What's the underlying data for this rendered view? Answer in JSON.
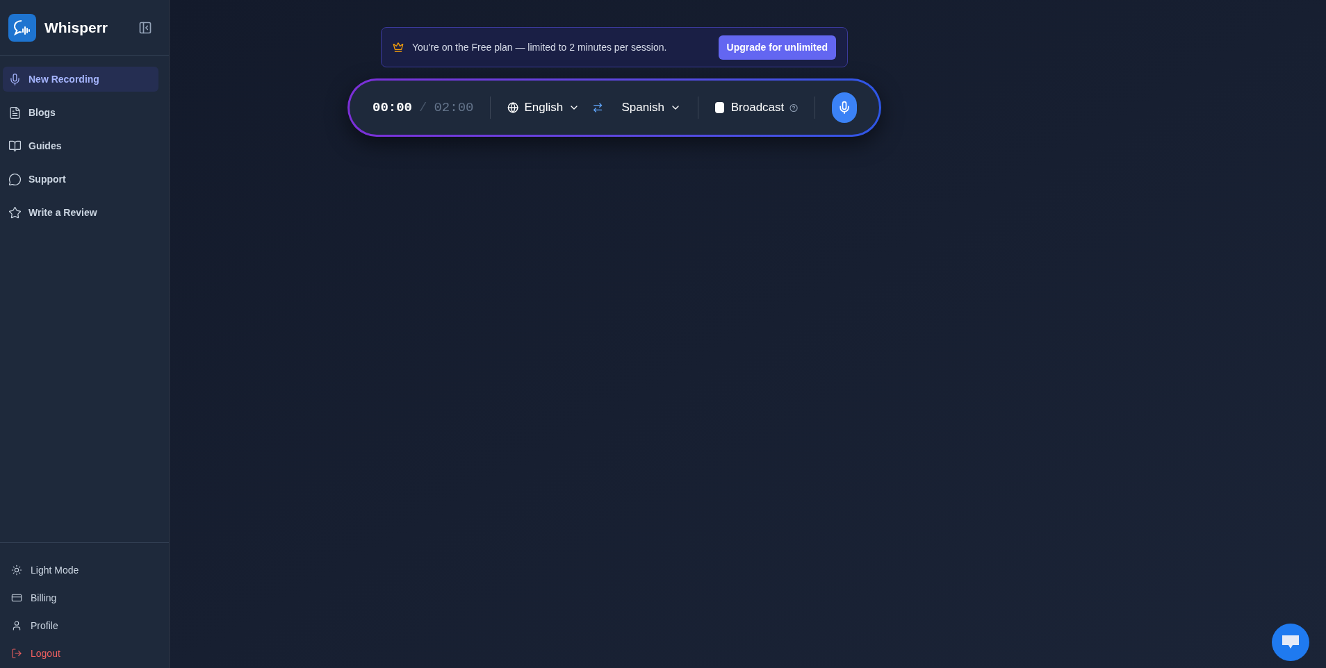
{
  "app": {
    "name": "Whisperr"
  },
  "nav": [
    {
      "label": "New Recording",
      "selected": true
    },
    {
      "label": "Blogs",
      "selected": false
    },
    {
      "label": "Guides",
      "selected": false
    },
    {
      "label": "Support",
      "selected": false
    },
    {
      "label": "Write a Review",
      "selected": false
    }
  ],
  "footer_nav": [
    {
      "label": "Light Mode",
      "kind": "normal"
    },
    {
      "label": "Billing",
      "kind": "normal"
    },
    {
      "label": "Profile",
      "kind": "normal"
    },
    {
      "label": "Logout",
      "kind": "danger"
    }
  ],
  "banner": {
    "text": "You're on the Free plan — limited to 2 minutes per session.",
    "button": "Upgrade for unlimited"
  },
  "recorder": {
    "elapsed": "00:00",
    "separator": "/",
    "limit": "02:00",
    "source_language": "English",
    "target_language": "Spanish",
    "broadcast": {
      "label": "Broadcast",
      "checked": false
    }
  }
}
